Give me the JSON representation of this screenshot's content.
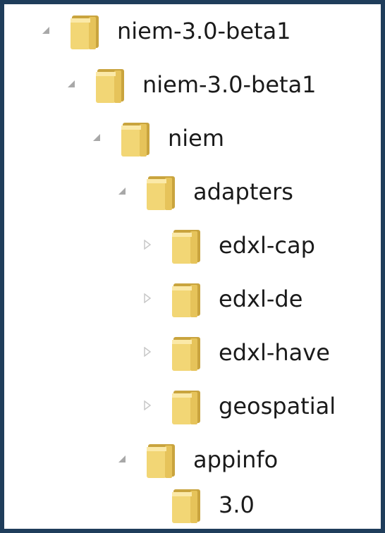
{
  "tree": {
    "items": [
      {
        "label": "niem-3.0-beta1",
        "state": "expanded"
      },
      {
        "label": "niem-3.0-beta1",
        "state": "expanded"
      },
      {
        "label": "niem",
        "state": "expanded"
      },
      {
        "label": "adapters",
        "state": "expanded"
      },
      {
        "label": "edxl-cap",
        "state": "collapsed"
      },
      {
        "label": "edxl-de",
        "state": "collapsed"
      },
      {
        "label": "edxl-have",
        "state": "collapsed"
      },
      {
        "label": "geospatial",
        "state": "collapsed"
      },
      {
        "label": "appinfo",
        "state": "expanded"
      },
      {
        "label": "3.0",
        "state": "leaf"
      }
    ]
  },
  "icons": {
    "folder": "folder-icon",
    "expanded": "expanded-arrow-icon",
    "collapsed": "collapsed-arrow-icon"
  },
  "colors": {
    "frame": "#1f3d5b",
    "folder_front": "#f2d675",
    "folder_back": "#d9b54a",
    "arrow": "#a8a8a8"
  }
}
